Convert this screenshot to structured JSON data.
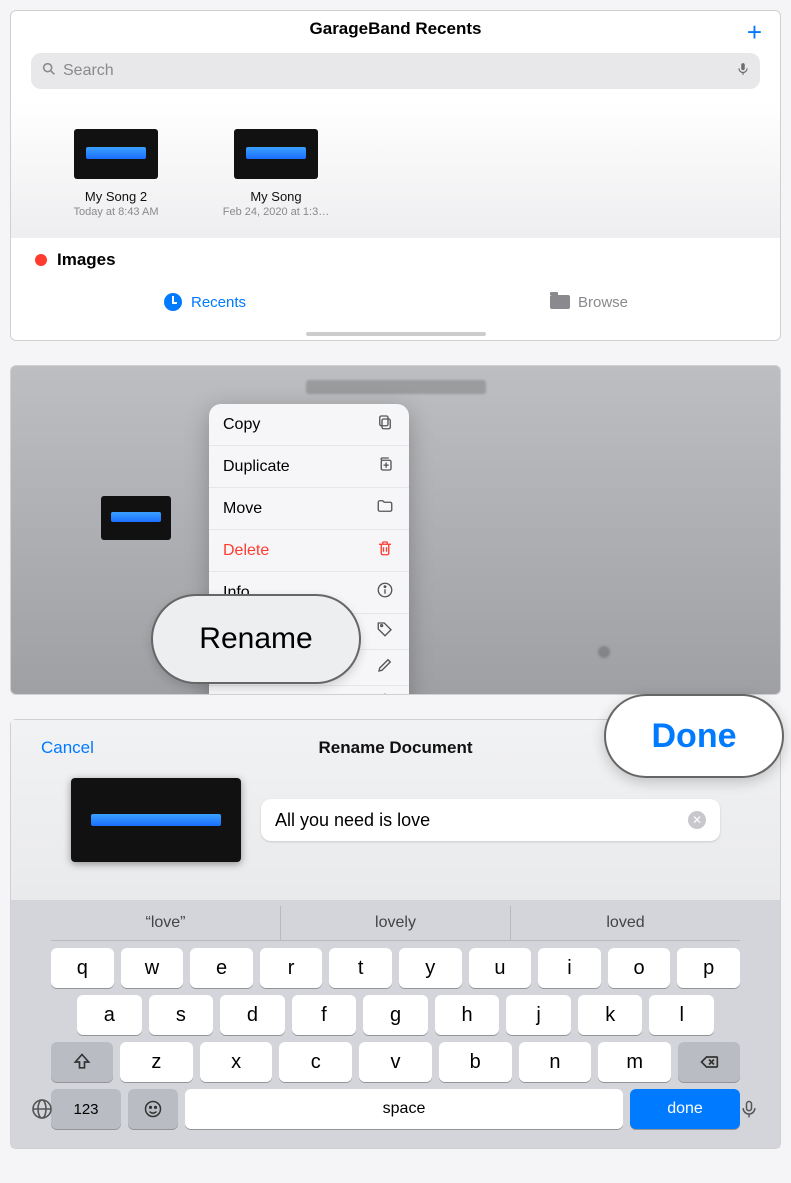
{
  "panel1": {
    "title": "GarageBand Recents",
    "search_placeholder": "Search",
    "files": [
      {
        "name": "My Song 2",
        "date": "Today at 8:43 AM"
      },
      {
        "name": "My Song",
        "date": "Feb 24, 2020 at 1:3…"
      }
    ],
    "section_header": "Images",
    "tabs": {
      "recents": "Recents",
      "browse": "Browse"
    }
  },
  "panel2": {
    "menu": {
      "copy": "Copy",
      "duplicate": "Duplicate",
      "move": "Move",
      "delete": "Delete",
      "info": "Info"
    },
    "callout": "Rename"
  },
  "panel3": {
    "cancel": "Cancel",
    "title": "Rename Document",
    "done_callout": "Done",
    "input_value": "All you need is love",
    "suggestions": [
      "“love”",
      "lovely",
      "loved"
    ],
    "keys_row1": [
      "q",
      "w",
      "e",
      "r",
      "t",
      "y",
      "u",
      "i",
      "o",
      "p"
    ],
    "keys_row2": [
      "a",
      "s",
      "d",
      "f",
      "g",
      "h",
      "j",
      "k",
      "l"
    ],
    "keys_row3": [
      "z",
      "x",
      "c",
      "v",
      "b",
      "n",
      "m"
    ],
    "key_123": "123",
    "key_space": "space",
    "key_done": "done"
  }
}
